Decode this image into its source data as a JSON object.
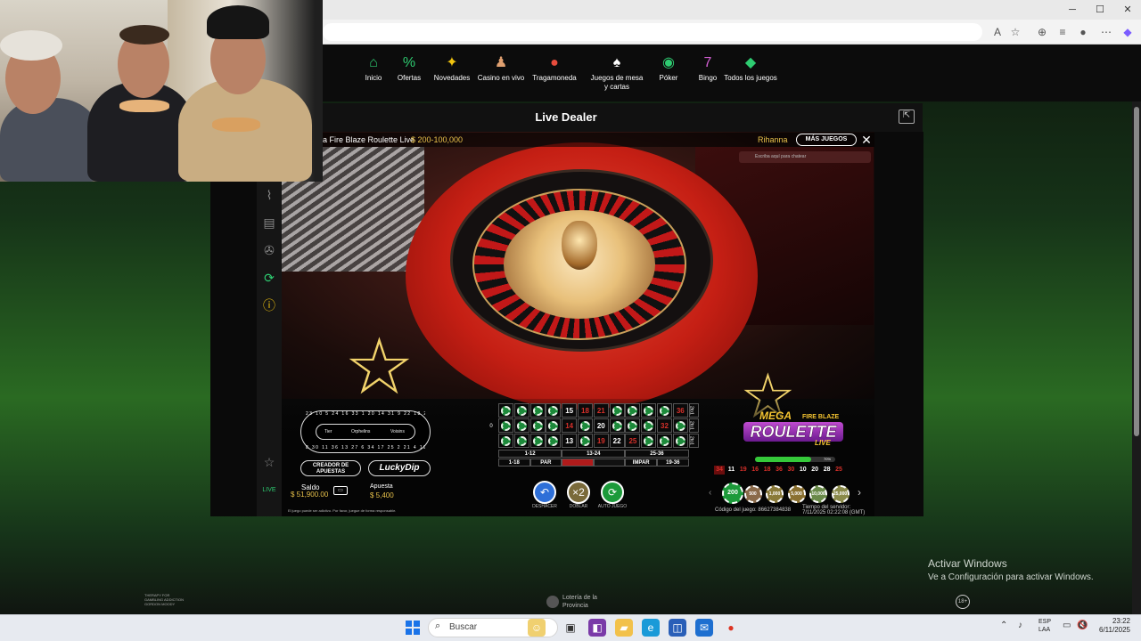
{
  "browser": {
    "window_controls": [
      "─",
      "☐",
      "✕"
    ],
    "icons": [
      "read-aloud-icon",
      "favorite-star-icon",
      "extensions-icon",
      "favorites-icon",
      "profile-icon",
      "more-icon",
      "copilot-icon"
    ]
  },
  "nav": {
    "items": [
      {
        "label": "Inicio",
        "icon": "home-icon",
        "glyph": "⌂",
        "color": "#2ecc71"
      },
      {
        "label": "Ofertas",
        "icon": "percent-icon",
        "glyph": "%",
        "color": "#2ecc71"
      },
      {
        "label": "Novedades",
        "icon": "sparkle-icon",
        "glyph": "✦",
        "color": "#f1c40f"
      },
      {
        "label": "Casino en vivo",
        "icon": "dealer-icon",
        "glyph": "♟",
        "color": "#e0a070"
      },
      {
        "label": "Tragamoneda",
        "icon": "cherry-icon",
        "glyph": "●",
        "color": "#e74c3c"
      },
      {
        "label": "Juegos de mesa y cartas",
        "icon": "cards-icon",
        "glyph": "♠",
        "color": "#ffffff"
      },
      {
        "label": "Póker",
        "icon": "poker-chip-icon",
        "glyph": "◉",
        "color": "#2ecc71"
      },
      {
        "label": "Bingo",
        "icon": "bingo-ball-icon",
        "glyph": "7",
        "color": "#d35fd3"
      },
      {
        "label": "Todos los juegos",
        "icon": "all-games-icon",
        "glyph": "◆",
        "color": "#2ecc71"
      }
    ]
  },
  "live_dealer": {
    "title": "Live Dealer"
  },
  "game": {
    "title": "ga Fire Blaze Roulette Live",
    "range": "$ 200-100,000",
    "dealer": "Rihanna",
    "more_games": "MÁS JUEGOS",
    "chat_placeholder": "Escriba aquí para chatear",
    "racetrack": {
      "labels": [
        "Tier",
        "Orphelins",
        "Voisins"
      ],
      "numbers_top": "23 10 5 24 16 33 1 20 14 31 9 22 18 29 7",
      "numbers_bottom": "8 30 11 36 13 27 6 34 17 25 2 21 4 19 15"
    },
    "creator_button": "CREADOR DE APUESTAS",
    "lucky_dip": "LuckyDip",
    "saldo_label": "Saldo",
    "saldo_value": "$ 51,900.00",
    "apuesta_label": "Apuesta",
    "apuesta_value": "$ 5,400",
    "disclaimer": "El juego puede ser adictivo. Por favor, juegue de forma responsable.",
    "grid": {
      "zero": "0",
      "rows": [
        [
          "3",
          "6",
          "9",
          "12",
          "15",
          "18",
          "21",
          "24",
          "27",
          "30",
          "33",
          "36"
        ],
        [
          "2",
          "5",
          "8",
          "11",
          "14",
          "17",
          "20",
          "23",
          "26",
          "29",
          "32",
          "35"
        ],
        [
          "1",
          "4",
          "7",
          "10",
          "13",
          "16",
          "19",
          "22",
          "25",
          "28",
          "31",
          "34"
        ]
      ],
      "reds": [
        "3",
        "9",
        "12",
        "18",
        "21",
        "27",
        "30",
        "36",
        "5",
        "14",
        "23",
        "32",
        "1",
        "7",
        "16",
        "19",
        "25",
        "34"
      ],
      "column_bets": [
        "2to1",
        "2to1",
        "2to1"
      ],
      "dozens": [
        "1-12",
        "13-24",
        "25-36"
      ],
      "outside": [
        "1-18",
        "PAR",
        "",
        "",
        "IMPAR",
        "19-36"
      ],
      "chipped": [
        "3",
        "6",
        "9",
        "12",
        "2",
        "5",
        "8",
        "11",
        "1",
        "4",
        "7",
        "10",
        "16",
        "17",
        "23",
        "24",
        "26",
        "27",
        "30",
        "29",
        "28",
        "31",
        "33",
        "34",
        "35"
      ]
    },
    "actions": [
      {
        "label": "DESHACER",
        "icon": "undo-icon",
        "glyph": "↶",
        "color": "#2e6fd8"
      },
      {
        "label": "DOBLAR",
        "icon": "double-icon",
        "glyph": "×2",
        "color": "#7a6a3a"
      },
      {
        "label": "AUTO JUEGO",
        "icon": "autoplay-icon",
        "glyph": "⟳",
        "color": "#1c9a3a"
      }
    ],
    "logo": {
      "mega": "MEGA",
      "fire": "FIRE BLAZE",
      "roulette": "ROULETTE",
      "live": "LIVE"
    },
    "progress": {
      "percent": 70,
      "label": "70%"
    },
    "history": [
      {
        "n": "34",
        "c": "#d6302a",
        "bg": "#6a0d0d"
      },
      {
        "n": "11",
        "c": "#ffffff",
        "bg": "transparent"
      },
      {
        "n": "19",
        "c": "#d6302a",
        "bg": "transparent"
      },
      {
        "n": "16",
        "c": "#d6302a",
        "bg": "transparent"
      },
      {
        "n": "18",
        "c": "#d6302a",
        "bg": "transparent"
      },
      {
        "n": "36",
        "c": "#d6302a",
        "bg": "transparent"
      },
      {
        "n": "30",
        "c": "#d6302a",
        "bg": "transparent"
      },
      {
        "n": "10",
        "c": "#ffffff",
        "bg": "transparent"
      },
      {
        "n": "20",
        "c": "#ffffff",
        "bg": "transparent"
      },
      {
        "n": "28",
        "c": "#ffffff",
        "bg": "transparent"
      },
      {
        "n": "25",
        "c": "#d6302a",
        "bg": "transparent"
      }
    ],
    "chips": [
      {
        "v": "200",
        "c": "#1c9a3a"
      },
      {
        "v": "500",
        "c": "#8a6a4a"
      },
      {
        "v": "1,000",
        "c": "#8a7a3a"
      },
      {
        "v": "5,000",
        "c": "#8a7030"
      },
      {
        "v": "10,000",
        "c": "#6a8a4a"
      },
      {
        "v": "25,000",
        "c": "#8a8a4a"
      }
    ],
    "code_label": "Código del juego: 86627384838",
    "server_time_label": "Tiempo del servidor:",
    "server_time_value": "7/11/2025 02:22:08 (GMT)"
  },
  "footer": {
    "gambling_logo": "THERAPY FOR GAMBLING ADDICTION GORDON MOODY",
    "loteria": "Lotería de la Provincia",
    "activate_title": "Activar Windows",
    "activate_sub": "Ve a Configuración para activar Windows.",
    "age": "18+"
  },
  "taskbar": {
    "search_placeholder": "Buscar",
    "lang": "ESP",
    "region": "LAA",
    "time": "23:22",
    "date": "6/11/2025"
  }
}
